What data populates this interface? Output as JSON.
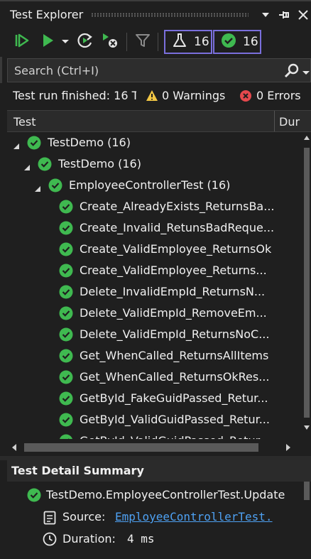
{
  "window": {
    "title": "Test Explorer"
  },
  "toolbar": {
    "total_count": "16",
    "passed_count": "16"
  },
  "search": {
    "placeholder": "Search (Ctrl+I)"
  },
  "summary": {
    "status": "Test run finished: 16 T",
    "warnings": "0 Warnings",
    "errors": "0 Errors"
  },
  "columns": {
    "test": "Test",
    "duration": "Dur"
  },
  "tree": [
    {
      "label": "TestDemo  (16)",
      "level": 0,
      "expandable": true
    },
    {
      "label": "TestDemo  (16)",
      "level": 1,
      "expandable": true
    },
    {
      "label": "EmployeeControllerTest  (16)",
      "level": 2,
      "expandable": true
    },
    {
      "label": "Create_AlreadyExists_ReturnsBa...",
      "level": 3,
      "expandable": false
    },
    {
      "label": "Create_Invalid_RetunsBadReque...",
      "level": 3,
      "expandable": false
    },
    {
      "label": "Create_ValidEmployee_ReturnsOk",
      "level": 3,
      "expandable": false
    },
    {
      "label": "Create_ValidEmployee_Returns...",
      "level": 3,
      "expandable": false
    },
    {
      "label": "Delete_InvalidEmpId_ReturnsN...",
      "level": 3,
      "expandable": false
    },
    {
      "label": "Delete_ValidEmpId_RemoveEm...",
      "level": 3,
      "expandable": false
    },
    {
      "label": "Delete_ValidEmpId_ReturnsNoC...",
      "level": 3,
      "expandable": false
    },
    {
      "label": "Get_WhenCalled_ReturnsAllItems",
      "level": 3,
      "expandable": false
    },
    {
      "label": "Get_WhenCalled_ReturnsOkRes...",
      "level": 3,
      "expandable": false
    },
    {
      "label": "GetById_FakeGuidPassed_Retur...",
      "level": 3,
      "expandable": false
    },
    {
      "label": "GetById_ValidGuidPassed_Retur...",
      "level": 3,
      "expandable": false
    },
    {
      "label": "GetById_ValidGuidPassed_Retur...",
      "level": 3,
      "expandable": false
    }
  ],
  "detail": {
    "title": "Test Detail Summary",
    "test_name": "TestDemo.EmployeeControllerTest.Update",
    "source_label": "Source:",
    "source_value": "EmployeeControllerTest.",
    "duration_label": "Duration:",
    "duration_value": "4 ms"
  },
  "colors": {
    "pass_green": "#3fb950",
    "accent_purple": "#7a6fdc",
    "warning_yellow": "#f2c744",
    "error_red": "#e5484d",
    "link_blue": "#4ea1f3"
  },
  "icons": {
    "toolbar": [
      "run-all-icon",
      "run-icon",
      "run-dropdown-icon",
      "repeat-last-run-icon",
      "cancel-run-icon",
      "test-settings-icon",
      "beaker-icon",
      "passed-check-icon"
    ],
    "window": [
      "dropdown-icon",
      "pin-icon",
      "close-icon"
    ],
    "search": "search-icon"
  }
}
